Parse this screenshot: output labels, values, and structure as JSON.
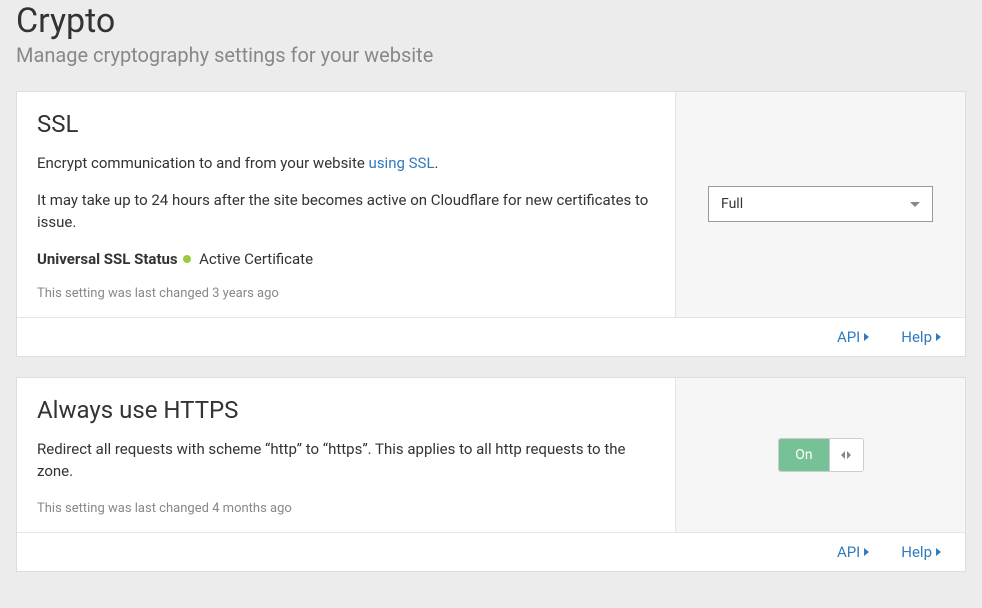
{
  "header": {
    "title": "Crypto",
    "subtitle": "Manage cryptography settings for your website"
  },
  "ssl": {
    "title": "SSL",
    "desc_pre": "Encrypt communication to and from your website ",
    "desc_link": "using SSL",
    "desc_post": ".",
    "note": "It may take up to 24 hours after the site becomes active on Cloudflare for new certificates to issue.",
    "status_label": "Universal SSL Status",
    "status_text": "Active Certificate",
    "meta": "This setting was last changed 3 years ago",
    "select_value": "Full",
    "footer_api": "API",
    "footer_help": "Help"
  },
  "https": {
    "title": "Always use HTTPS",
    "desc": "Redirect all requests with scheme “http” to “https”. This applies to all http requests to the zone.",
    "meta": "This setting was last changed 4 months ago",
    "toggle_label": "On",
    "footer_api": "API",
    "footer_help": "Help"
  }
}
